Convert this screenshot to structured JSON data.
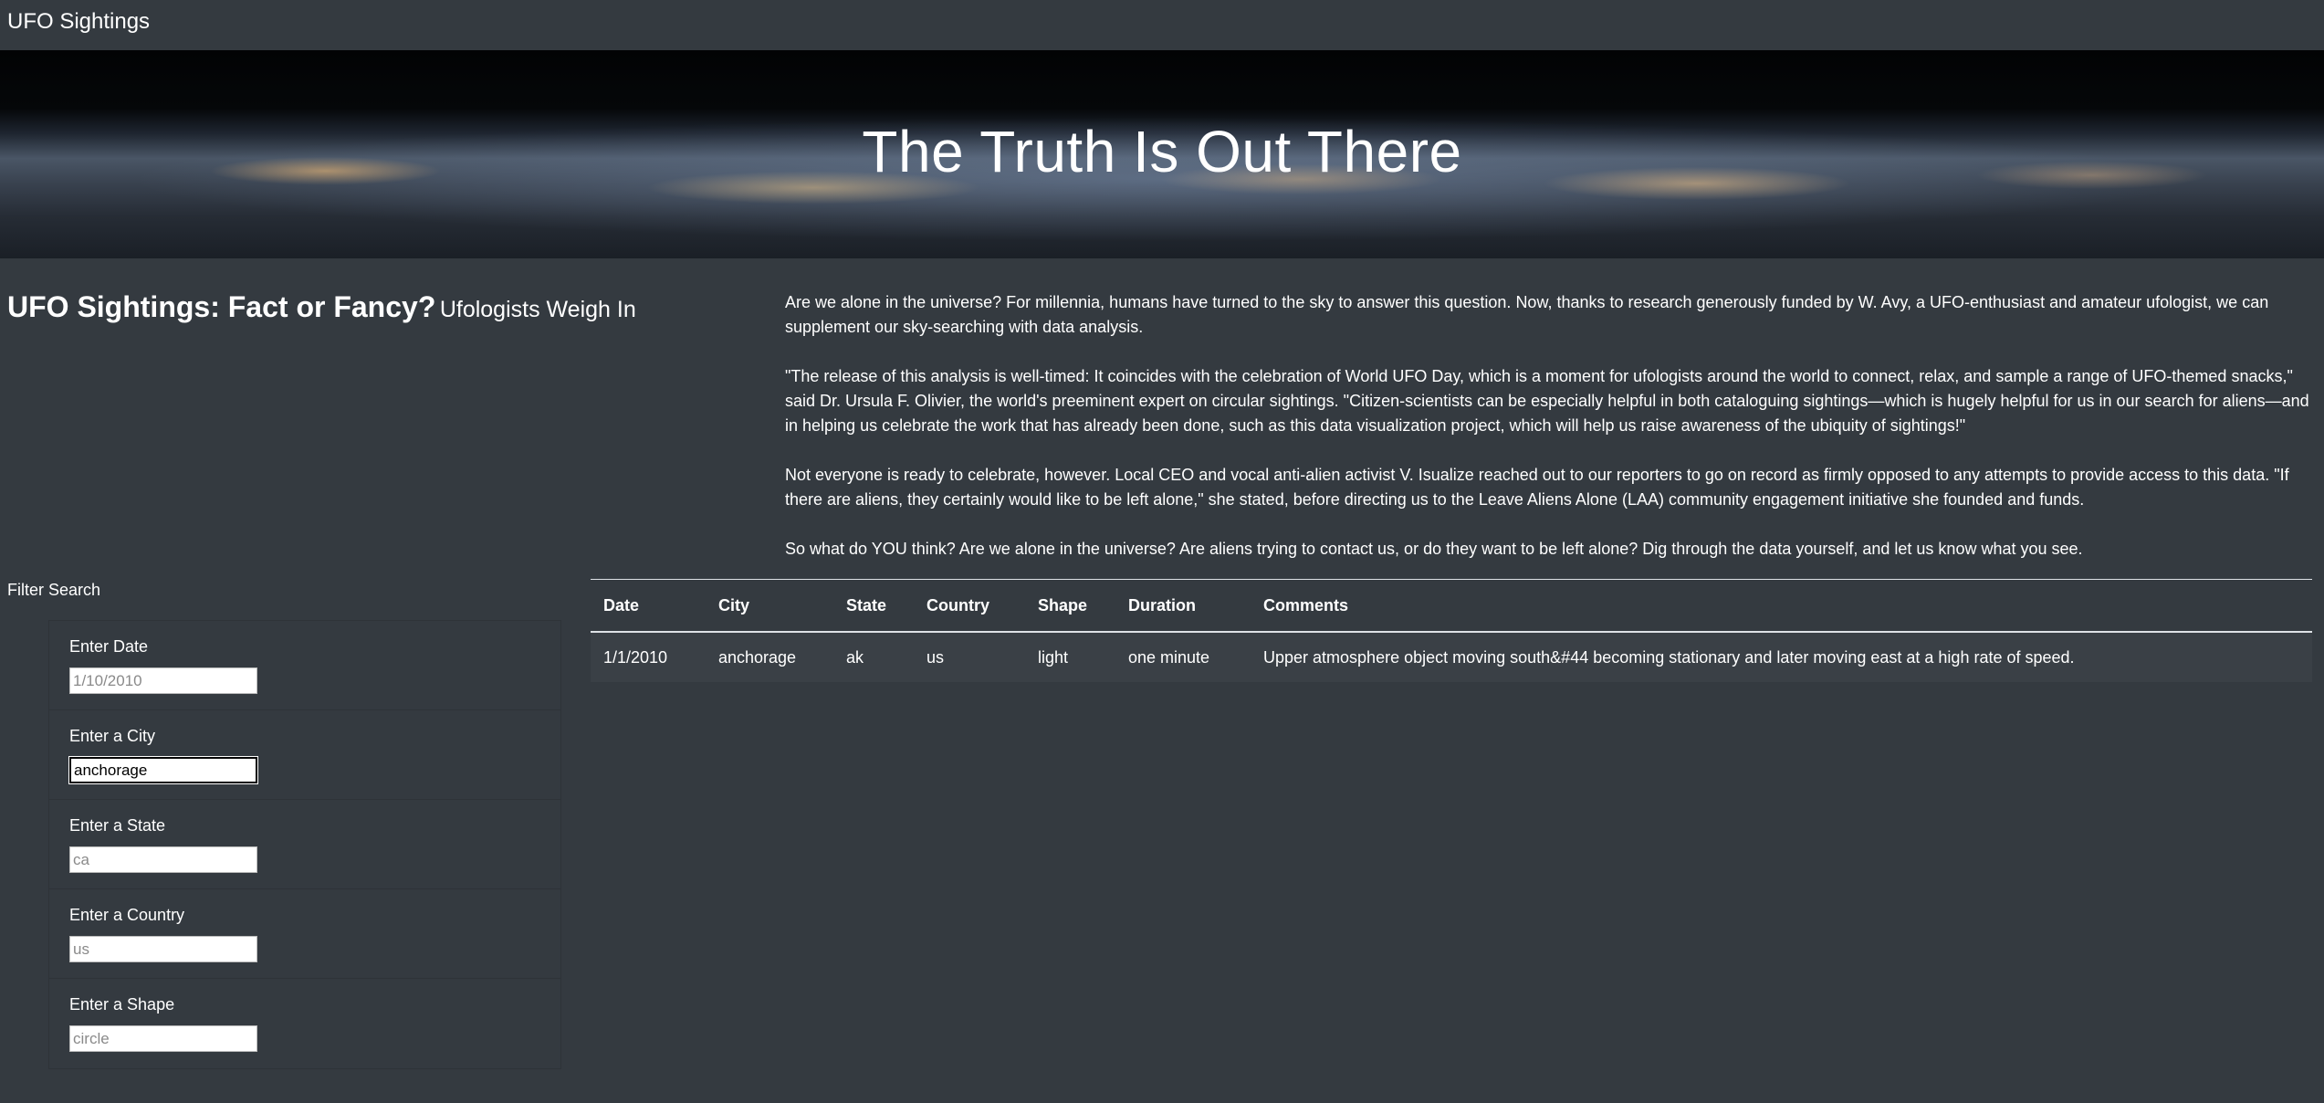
{
  "navbar": {
    "brand": "UFO Sightings"
  },
  "hero": {
    "title": "The Truth Is Out There"
  },
  "lead": {
    "title": "UFO Sightings: Fact or Fancy?",
    "subtitle": "Ufologists Weigh In"
  },
  "article": {
    "paragraphs": [
      "Are we alone in the universe? For millennia, humans have turned to the sky to answer this question. Now, thanks to research generously funded by W. Avy, a UFO-enthusiast and amateur ufologist, we can supplement our sky-searching with data analysis.",
      "\"The release of this analysis is well-timed: It coincides with the celebration of World UFO Day, which is a moment for ufologists around the world to connect, relax, and sample a range of UFO-themed snacks,\" said Dr. Ursula F. Olivier, the world's preeminent expert on circular sightings. \"Citizen-scientists can be especially helpful in both cataloguing sightings—which is hugely helpful for us in our search for aliens—and in helping us celebrate the work that has already been done, such as this data visualization project, which will help us raise awareness of the ubiquity of sightings!\"",
      "Not everyone is ready to celebrate, however. Local CEO and vocal anti-alien activist V. Isualize reached out to our reporters to go on record as firmly opposed to any attempts to provide access to this data. \"If there are aliens, they certainly would like to be left alone,\" she stated, before directing us to the Leave Aliens Alone (LAA) community engagement initiative she founded and funds.",
      "So what do YOU think? Are we alone in the universe? Are aliens trying to contact us, or do they want to be left alone? Dig through the data yourself, and let us know what you see."
    ]
  },
  "filters": {
    "heading": "Filter Search",
    "items": [
      {
        "label": "Enter Date",
        "value": "",
        "placeholder": "1/10/2010"
      },
      {
        "label": "Enter a City",
        "value": "anchorage",
        "placeholder": ""
      },
      {
        "label": "Enter a State",
        "value": "",
        "placeholder": "ca"
      },
      {
        "label": "Enter a Country",
        "value": "",
        "placeholder": "us"
      },
      {
        "label": "Enter a Shape",
        "value": "",
        "placeholder": "circle"
      }
    ]
  },
  "table": {
    "headers": [
      "Date",
      "City",
      "State",
      "Country",
      "Shape",
      "Duration",
      "Comments"
    ],
    "rows": [
      [
        "1/1/2010",
        "anchorage",
        "ak",
        "us",
        "light",
        "one minute",
        "Upper atmosphere object moving south&#44 becoming stationary and later moving east at a high rate of speed."
      ]
    ]
  }
}
